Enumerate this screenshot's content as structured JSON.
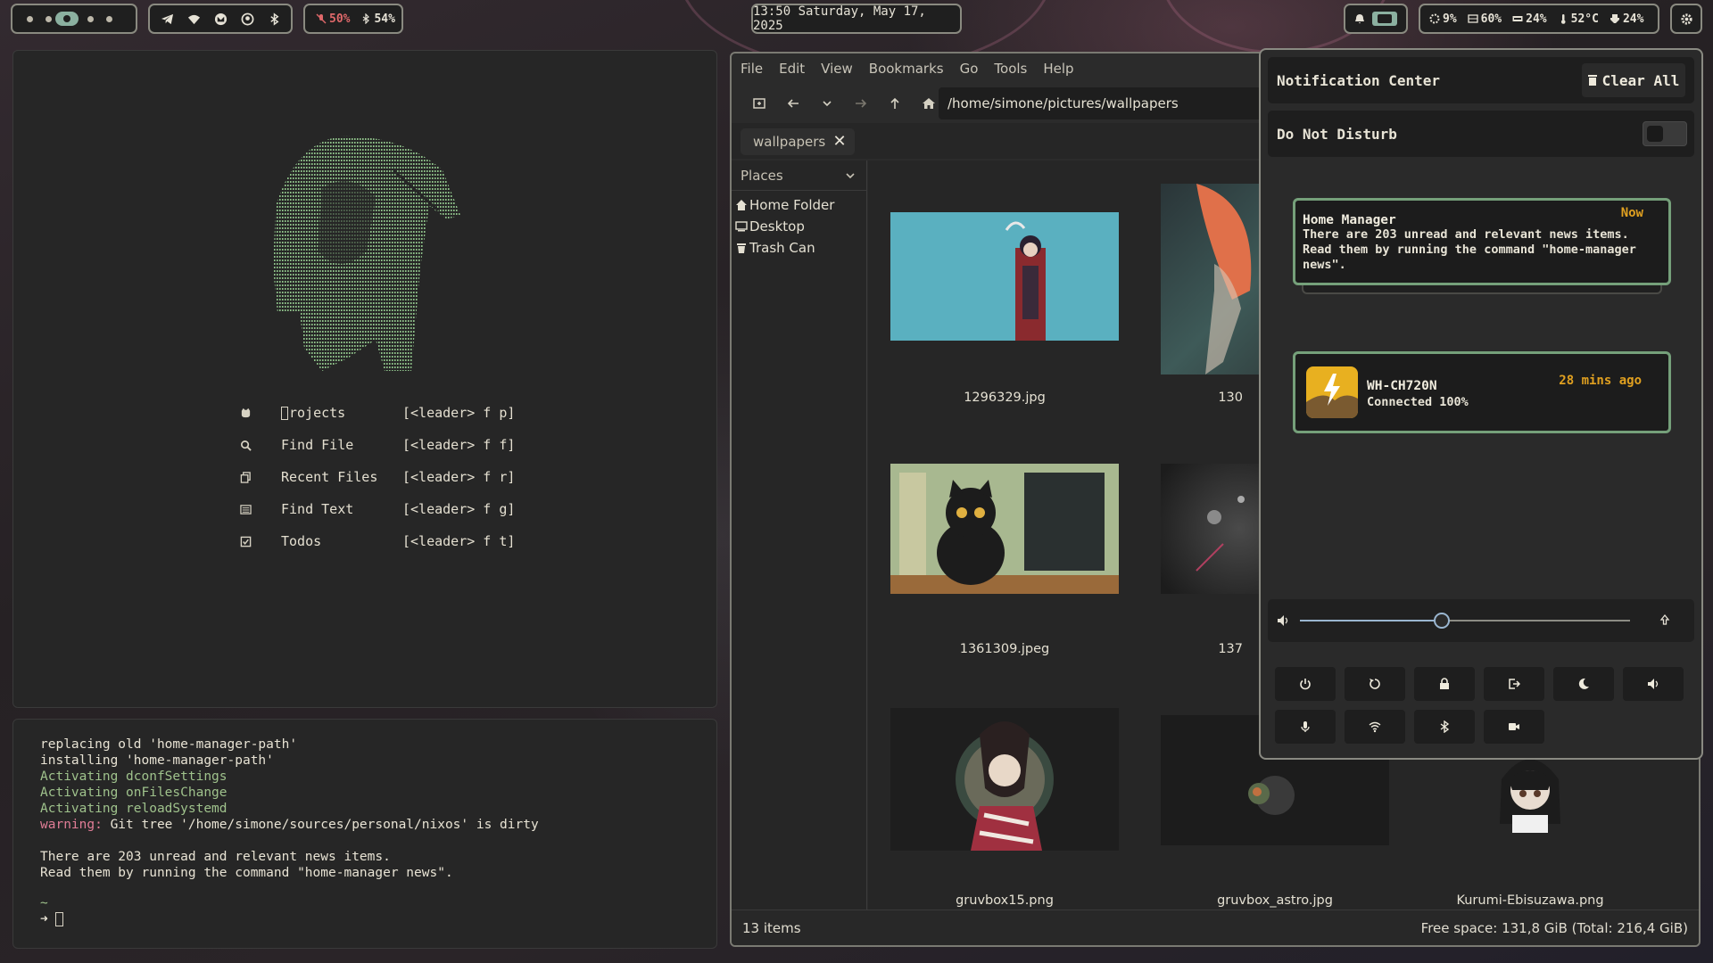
{
  "topbar": {
    "workspaces": [
      "1",
      "2",
      "3",
      "4",
      "5"
    ],
    "active_workspace": 3,
    "tray_icons": [
      "telegram-icon",
      "wifi-icon",
      "mail-icon",
      "github-icon",
      "bluetooth-icon"
    ],
    "mic_level": "50%",
    "bluetooth_battery": "54%",
    "clock": "13:50 Saturday, May 17, 2025",
    "stats": {
      "cpu": "9%",
      "ram": "60%",
      "disk": "24%",
      "temp": "52°C",
      "battery": "24%"
    }
  },
  "nvim_dashboard": {
    "items": [
      {
        "icon": "github-icon",
        "label": "Projects",
        "keys": "[<leader> f p]"
      },
      {
        "icon": "search-icon",
        "label": "Find File",
        "keys": "[<leader> f f]"
      },
      {
        "icon": "copy-icon",
        "label": "Recent Files",
        "keys": "[<leader> f r]"
      },
      {
        "icon": "list-icon",
        "label": "Find Text",
        "keys": "[<leader> f g]"
      },
      {
        "icon": "checkbox-icon",
        "label": "Todos",
        "keys": "[<leader> f t]"
      }
    ]
  },
  "terminal": {
    "lines": [
      "replacing old 'home-manager-path'",
      "installing 'home-manager-path'",
      "Activating dconfSettings",
      "Activating onFilesChange",
      "Activating reloadSystemd"
    ],
    "warning_prefix": "warning:",
    "warning_text": " Git tree '/home/simone/sources/personal/nixos' is dirty",
    "news_line1": "There are 203 unread and relevant news items.",
    "news_line2": "Read them by running the command \"home-manager news\".",
    "prompt_dir": "~",
    "prompt_arrow": "➜"
  },
  "file_manager": {
    "menu": [
      "File",
      "Edit",
      "View",
      "Bookmarks",
      "Go",
      "Tools",
      "Help"
    ],
    "path": "/home/simone/pictures/wallpapers",
    "tab_label": "wallpapers",
    "places_label": "Places",
    "places": [
      {
        "icon": "home-icon",
        "label": "Home Folder"
      },
      {
        "icon": "desktop-icon",
        "label": "Desktop"
      },
      {
        "icon": "trash-icon",
        "label": "Trash Can"
      }
    ],
    "files": [
      "1296329.jpg",
      "130",
      "1361309.jpeg",
      "137",
      "gruvbox15.png",
      "gruvbox_astro.jpg",
      "Kurumi-Ebisuzawa.png"
    ],
    "item_count": "13 items",
    "free_space": "Free space: 131,8 GiB (Total: 216,4 GiB)"
  },
  "notification_center": {
    "title": "Notification Center",
    "clear_all": "Clear All",
    "dnd_label": "Do Not Disturb",
    "dnd_enabled": false,
    "notifications": [
      {
        "title": "Home Manager",
        "time": "Now",
        "body": "There are 203 unread and relevant news items. Read them by running the command \"home-manager news\"."
      },
      {
        "title": "WH-CH720N",
        "time": "28 mins ago",
        "body": "Connected 100%"
      }
    ],
    "volume": 0.43,
    "quick_actions_row1": [
      "power-icon",
      "restart-icon",
      "lock-icon",
      "logout-icon",
      "moon-icon",
      "volume-icon"
    ],
    "quick_actions_row2": [
      "mic-icon",
      "wifi-icon",
      "bluetooth-icon",
      "camera-icon"
    ]
  },
  "colors": {
    "accent_green": "#75a07a",
    "accent_orange": "#e0a020",
    "warning_pink": "#e07d96",
    "terminal_green": "#9fc28c"
  }
}
